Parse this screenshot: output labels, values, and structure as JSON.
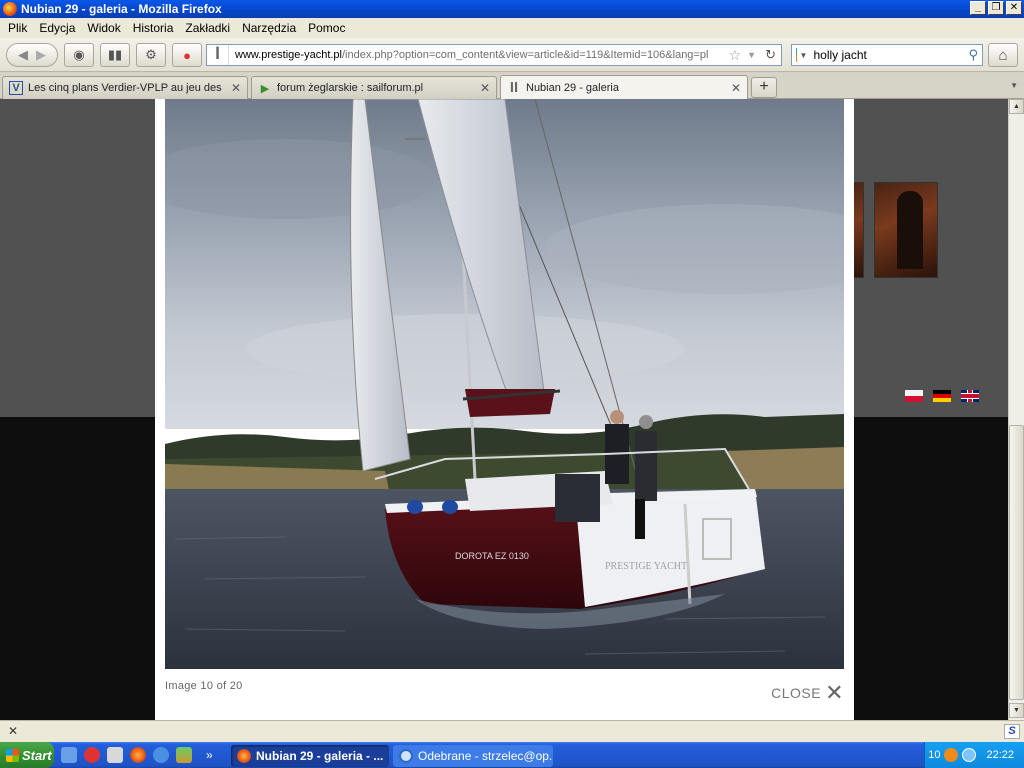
{
  "window": {
    "title": "Nubian 29 - galeria - Mozilla Firefox"
  },
  "menubar": {
    "items": [
      "Plik",
      "Edycja",
      "Widok",
      "Historia",
      "Zakładki",
      "Narzędzia",
      "Pomoc"
    ]
  },
  "navbar": {
    "url_domain": "www.prestige-yacht.pl",
    "url_path": "/index.php?option=com_content&view=article&id=119&Itemid=106&lang=pl",
    "search_value": "holly jacht"
  },
  "tabs": [
    {
      "label": "Les cinq plans Verdier-VPLP au jeu des se...",
      "active": false
    },
    {
      "label": "forum żeglarskie : sailforum.pl",
      "active": false
    },
    {
      "label": "Nubian 29 - galeria",
      "active": true
    }
  ],
  "lightbox": {
    "caption": "Image 10 of 20",
    "close_label": "CLOSE",
    "boat_text": "PRESTIGE   YACHT",
    "boat_name": "DOROTA  EZ 0130"
  },
  "taskbar": {
    "start_label": "Start",
    "items": [
      {
        "label": "Nubian 29 - galeria - ...",
        "active": true
      },
      {
        "label": "Odebrane - strzelec@op....",
        "active": false
      }
    ],
    "tray_number": "10",
    "clock": "22:22"
  },
  "colors": {
    "titlebar": "#0a4fd6",
    "content_dark": "#0e0e0e",
    "content_grey": "#515151",
    "hull": "#4a0d14"
  }
}
